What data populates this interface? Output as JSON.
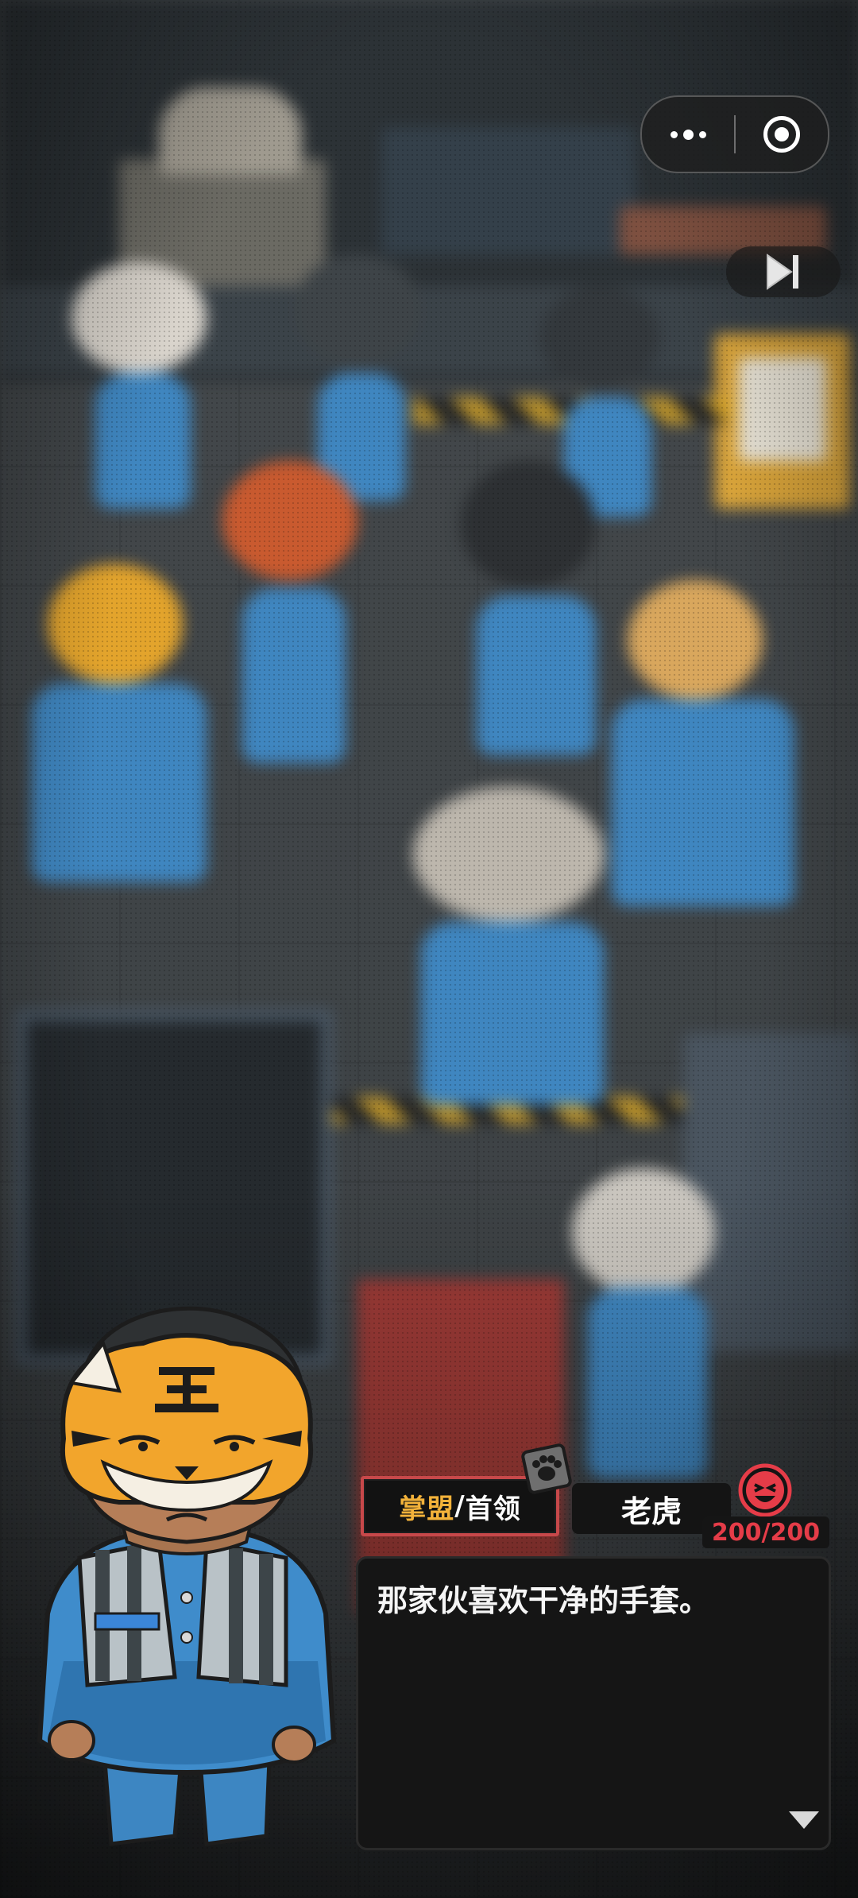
{
  "topbar": {
    "menu_icon": "more-dots-icon",
    "close_icon": "target-circle-icon",
    "skip_icon": "skip-forward-icon"
  },
  "dialogue": {
    "faction": "掌盟",
    "separator": "/",
    "role": "首领",
    "speaker_name": "老虎",
    "affection": "200/200",
    "line": "那家伙喜欢干净的手套。",
    "continue_icon": "triangle-down-icon",
    "badge_icon": "paw-print-icon",
    "mood_icon": "laughing-face-icon"
  },
  "colors": {
    "accent_red": "#c7484a",
    "faction_gold": "#f3b23a",
    "hp_red": "#e53c48",
    "panel_dark": "#151515"
  }
}
